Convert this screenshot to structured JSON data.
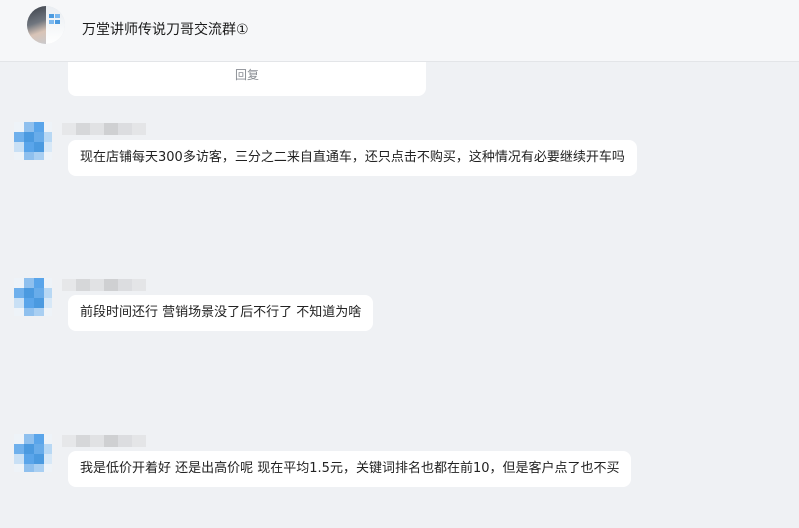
{
  "header": {
    "title": "万堂讲师传说刀哥交流群①"
  },
  "top_card": {
    "reply_label": "回复"
  },
  "messages": [
    {
      "text": "现在店铺每天300多访客，三分之二来自直通车，还只点击不购买，这种情况有必要继续开车吗"
    },
    {
      "text": "前段时间还行 营销场景没了后不行了 不知道为啥"
    },
    {
      "text": "我是低价开着好 还是出高价呢 现在平均1.5元，关键词排名也都在前10，但是客户点了也不买"
    }
  ],
  "colors": {
    "background": "#eff1f4",
    "header_bg": "#f6f7f9",
    "bubble_bg": "#ffffff",
    "avatar_blue": "#4b9ae0"
  }
}
